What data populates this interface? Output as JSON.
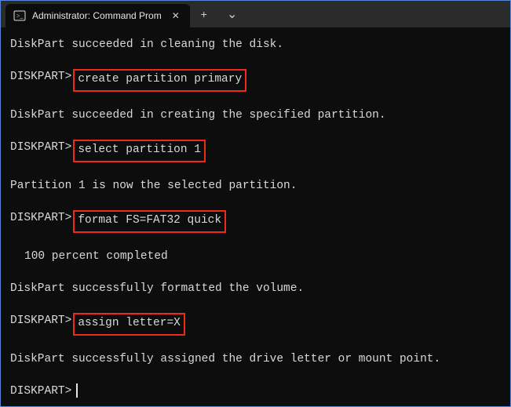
{
  "titlebar": {
    "tab_title": "Administrator: Command Prom",
    "close_glyph": "✕",
    "newtab_glyph": "+",
    "menu_glyph": "⌄"
  },
  "terminal": {
    "prompt": "DISKPART>",
    "lines": {
      "clean_ok": "DiskPart succeeded in cleaning the disk.",
      "create_part": "create partition primary",
      "create_ok": "DiskPart succeeded in creating the specified partition.",
      "select_part": "select partition 1",
      "select_ok": "Partition 1 is now the selected partition.",
      "format_cmd": "format FS=FAT32 quick",
      "progress": "100 percent completed",
      "format_ok": "DiskPart successfully formatted the volume.",
      "assign_cmd": "assign letter=X",
      "assign_ok": "DiskPart successfully assigned the drive letter or mount point."
    }
  }
}
